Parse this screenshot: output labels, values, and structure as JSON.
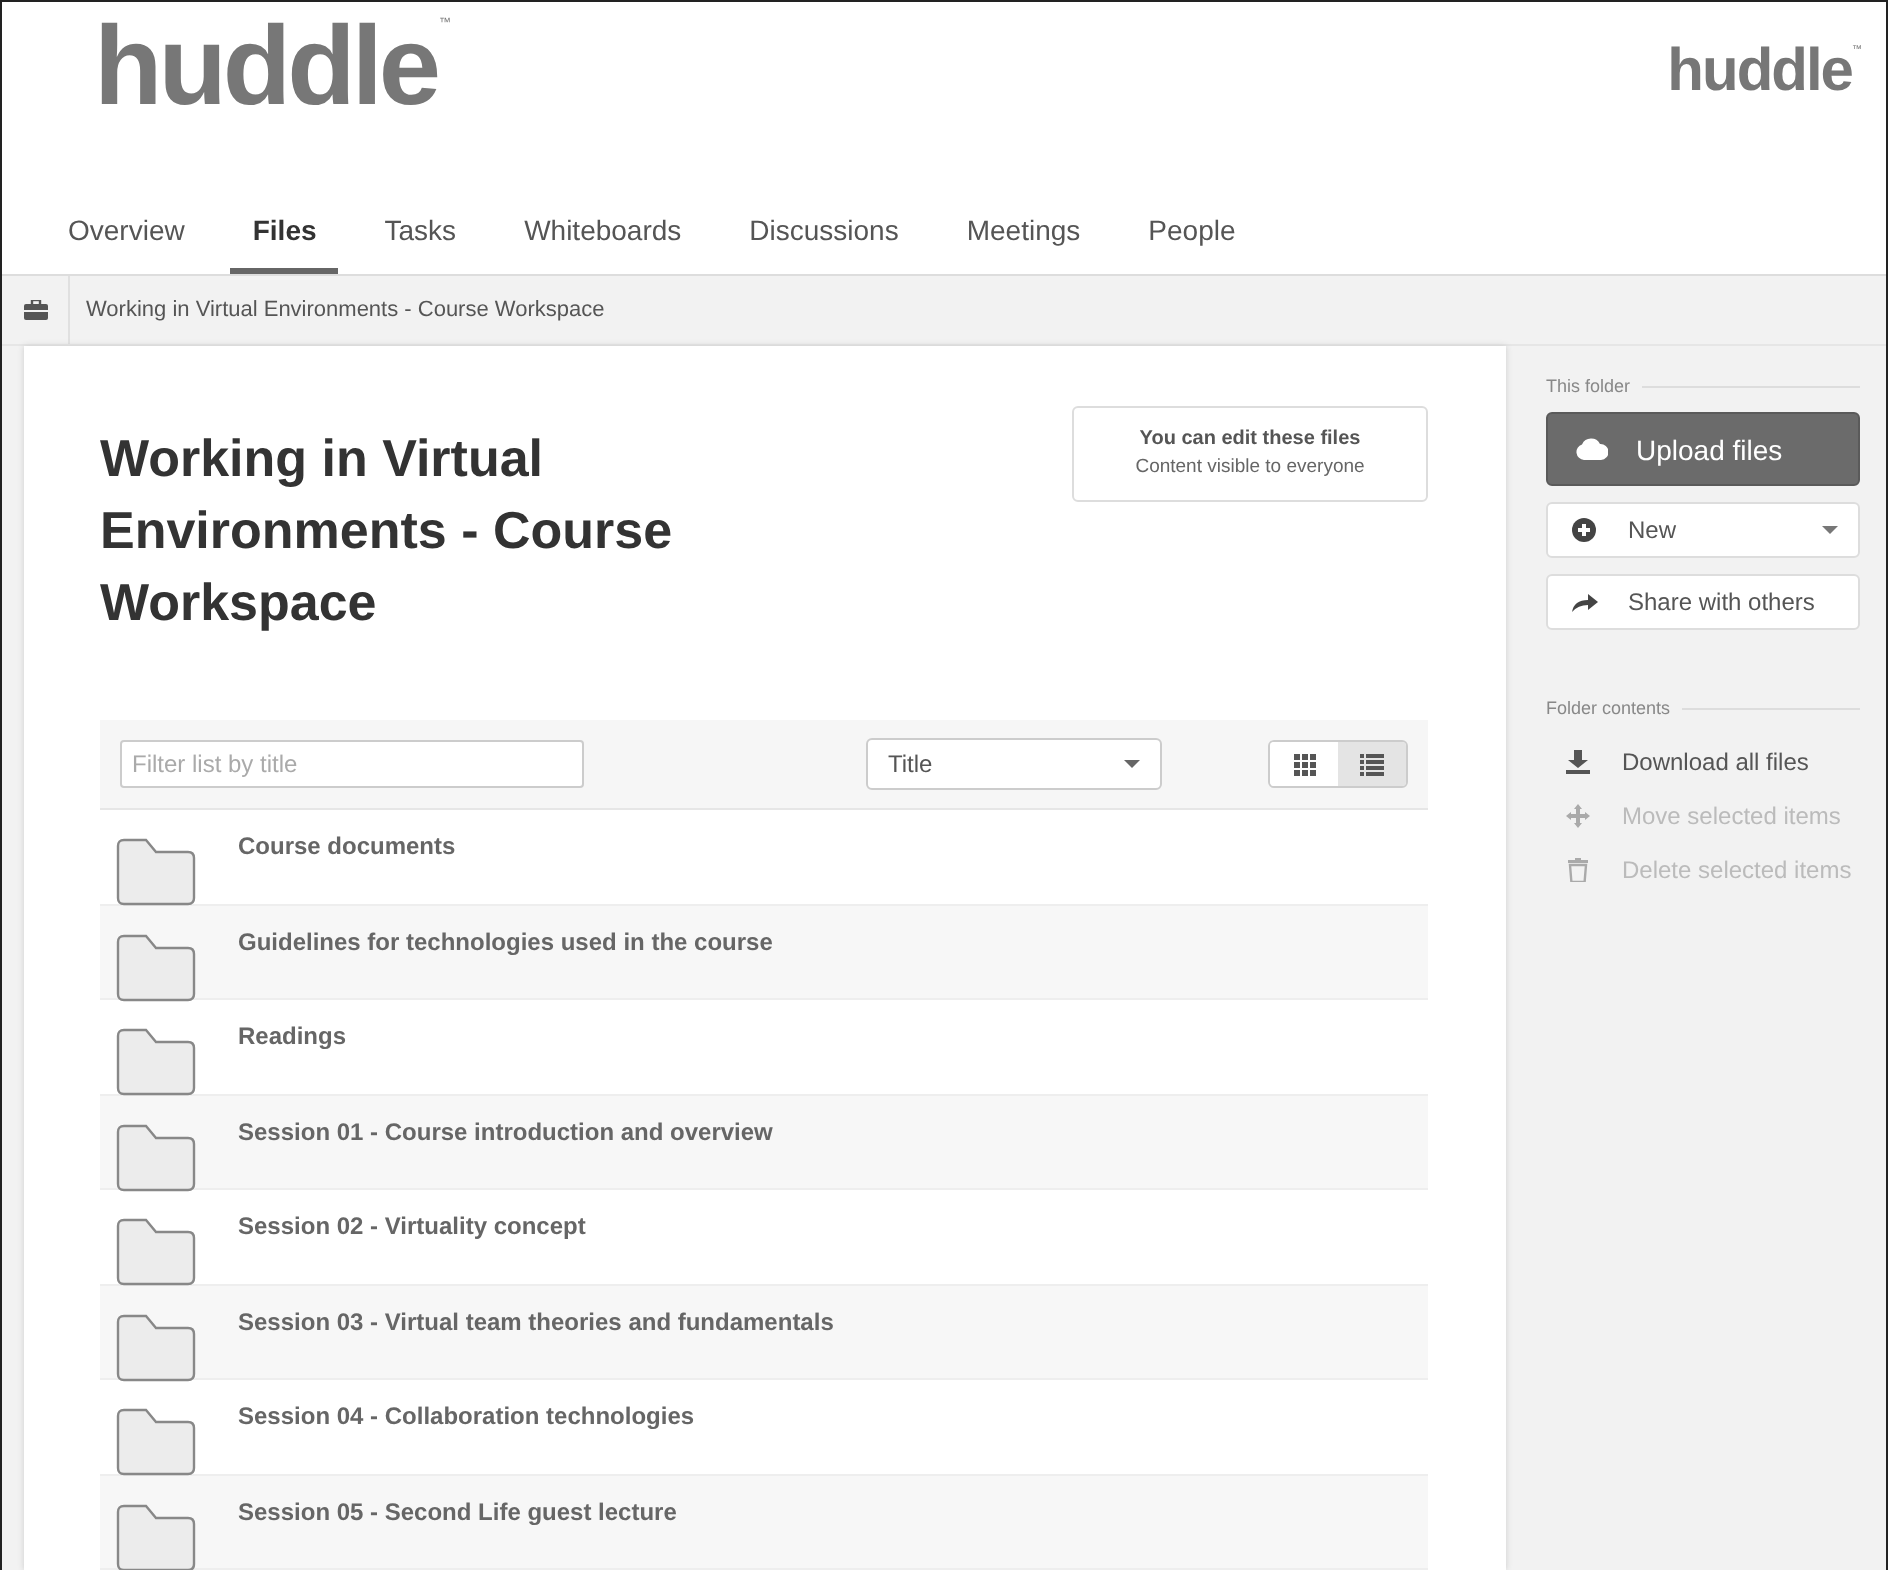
{
  "header": {
    "logo": {
      "text": "huddle",
      "mark": "™"
    },
    "brand": {
      "text": "huddle",
      "mark": "™"
    }
  },
  "tabs": [
    {
      "label": "Overview",
      "selected": false
    },
    {
      "label": "Files",
      "selected": true
    },
    {
      "label": "Tasks",
      "selected": false
    },
    {
      "label": "Whiteboards",
      "selected": false
    },
    {
      "label": "Discussions",
      "selected": false
    },
    {
      "label": "Meetings",
      "selected": false
    },
    {
      "label": "People",
      "selected": false
    }
  ],
  "breadcrumb": "Working in Virtual Environments - Course Workspace",
  "workspace": {
    "title": "Working in Virtual Environments - Course Workspace",
    "permissions": {
      "title": "You can edit these files",
      "subtitle": "Content visible to everyone"
    }
  },
  "toolbar": {
    "filter": {
      "placeholder": "Filter list by title"
    },
    "sort": "Title",
    "views": [
      {
        "kind": "grid",
        "selected": false
      },
      {
        "kind": "list",
        "selected": true
      }
    ]
  },
  "folders": [
    {
      "name": "Course documents"
    },
    {
      "name": "Guidelines for technologies used in the course"
    },
    {
      "name": "Readings"
    },
    {
      "name": "Session 01 - Course introduction and overview"
    },
    {
      "name": "Session 02 - Virtuality concept"
    },
    {
      "name": "Session 03 - Virtual team theories and fundamentals"
    },
    {
      "name": "Session 04 - Collaboration technologies"
    },
    {
      "name": "Session 05 - Second Life guest lecture"
    }
  ],
  "sidebar": {
    "this_folder": {
      "heading": "This folder",
      "actions": [
        {
          "kind": "upload",
          "label": "Upload files"
        },
        {
          "kind": "new",
          "label": "New"
        },
        {
          "kind": "share",
          "label": "Share with others"
        }
      ]
    },
    "folder_contents": {
      "heading": "Folder contents",
      "actions": [
        {
          "kind": "download",
          "label": "Download all files",
          "disabled": false
        },
        {
          "kind": "move",
          "label": "Move selected items",
          "disabled": true
        },
        {
          "kind": "delete",
          "label": "Delete selected items",
          "disabled": true
        }
      ]
    }
  }
}
